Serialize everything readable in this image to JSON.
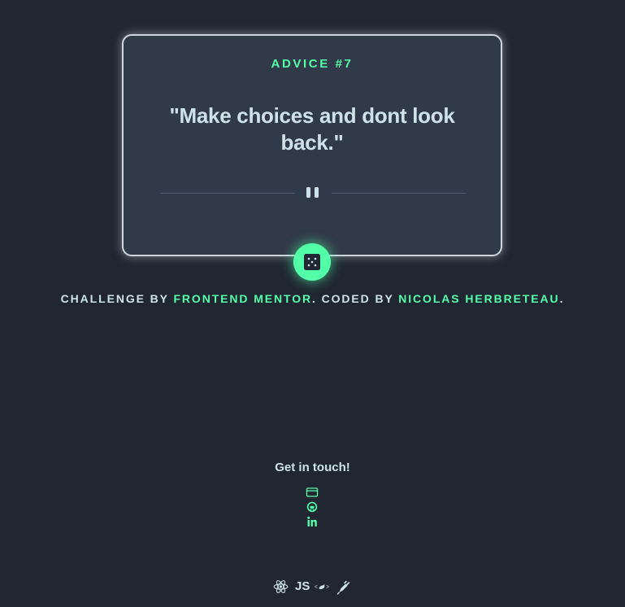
{
  "card": {
    "advice_label": "ADVICE #7",
    "quote": "\"Make choices and dont look back.\""
  },
  "dice_button": {
    "icon": "dice-icon",
    "color": "#52ffa8"
  },
  "attribution": {
    "prefix": "CHALLENGE BY ",
    "challenge_link": "FRONTEND MENTOR",
    "middle": ". CODED BY ",
    "author_link": "NICOLAS HERBRETEAU",
    "suffix": "."
  },
  "contact": {
    "title": "Get in touch!",
    "links": [
      {
        "icon": "portfolio-card-icon"
      },
      {
        "icon": "github-icon"
      },
      {
        "icon": "linkedin-icon"
      }
    ]
  },
  "tech_stack": {
    "items": [
      {
        "icon": "react-icon"
      },
      {
        "icon": "javascript-icon",
        "label": "JS"
      },
      {
        "icon": "styled-components-icon"
      },
      {
        "icon": "vite-icon"
      }
    ]
  },
  "colors": {
    "background": "#202632",
    "card": "#313a48",
    "accent": "#52ffa8",
    "text": "#cee3e9",
    "divider": "#4f5d74"
  }
}
